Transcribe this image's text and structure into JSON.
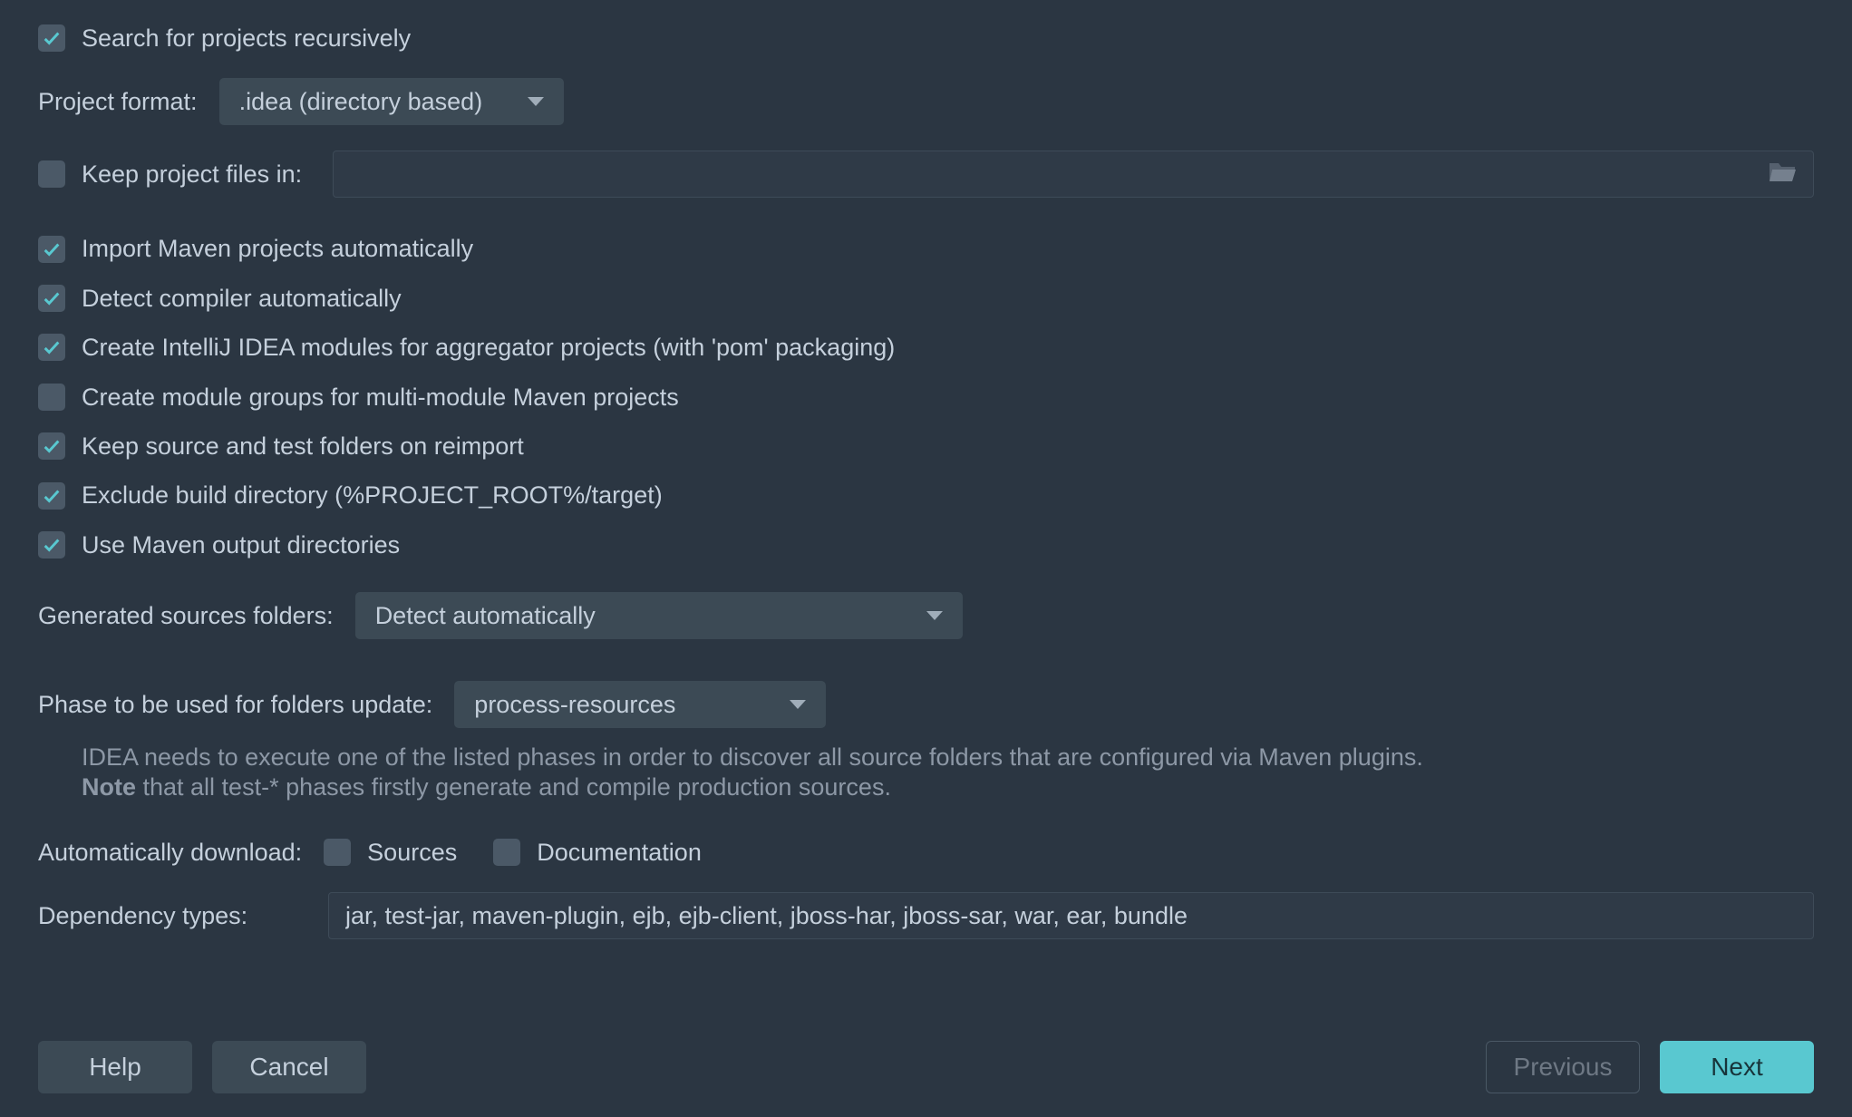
{
  "search_recursively": {
    "label": "Search for projects recursively",
    "checked": true
  },
  "project_format": {
    "label": "Project format:",
    "value": ".idea (directory based)"
  },
  "keep_project_files": {
    "label": "Keep project files in:",
    "checked": false,
    "value": ""
  },
  "options": [
    {
      "label": "Import Maven projects automatically",
      "checked": true
    },
    {
      "label": "Detect compiler automatically",
      "checked": true
    },
    {
      "label": "Create IntelliJ IDEA modules for aggregator projects (with 'pom' packaging)",
      "checked": true
    },
    {
      "label": "Create module groups for multi-module Maven projects",
      "checked": false
    },
    {
      "label": "Keep source and test folders on reimport",
      "checked": true
    },
    {
      "label": "Exclude build directory (%PROJECT_ROOT%/target)",
      "checked": true
    },
    {
      "label": "Use Maven output directories",
      "checked": true
    }
  ],
  "generated_sources": {
    "label": "Generated sources folders:",
    "value": "Detect automatically"
  },
  "phase": {
    "label": "Phase to be used for folders update:",
    "value": "process-resources",
    "help_line1": "IDEA needs to execute one of the listed phases in order to discover all source folders that are configured via Maven plugins.",
    "help_note_bold": "Note",
    "help_line2": " that all test-* phases firstly generate and compile production sources."
  },
  "auto_download": {
    "label": "Automatically download:",
    "sources": {
      "label": "Sources",
      "checked": false
    },
    "docs": {
      "label": "Documentation",
      "checked": false
    }
  },
  "dependency_types": {
    "label": "Dependency types:",
    "value": "jar, test-jar, maven-plugin, ejb, ejb-client, jboss-har, jboss-sar, war, ear, bundle"
  },
  "footer": {
    "help": "Help",
    "cancel": "Cancel",
    "previous": "Previous",
    "next": "Next"
  }
}
